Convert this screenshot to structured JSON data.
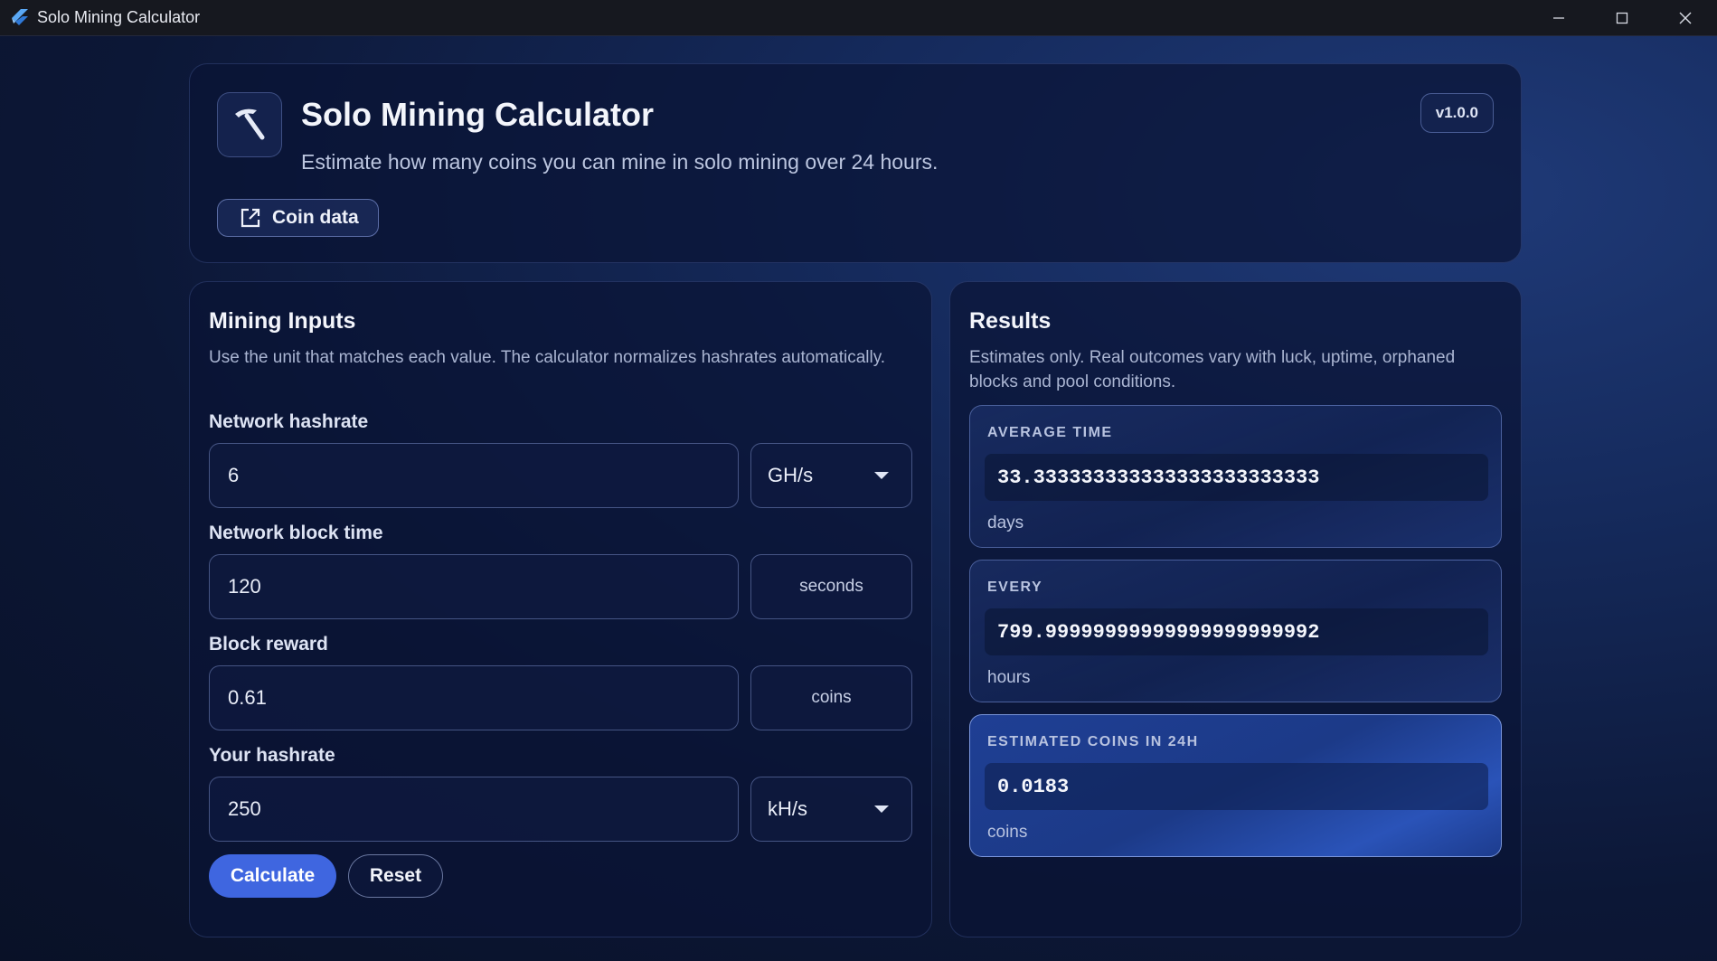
{
  "window": {
    "title": "Solo Mining Calculator",
    "minimize_glyph": "─",
    "maximize_glyph": "☐",
    "close_glyph": "✕"
  },
  "header": {
    "title": "Solo Mining Calculator",
    "subtitle": "Estimate how many coins you can mine in solo mining over 24 hours.",
    "version": "v1.0.0",
    "coin_data_label": "Coin data",
    "logo_icon": "pickaxe-icon",
    "coin_data_icon": "external-link-icon"
  },
  "inputs": {
    "title": "Mining Inputs",
    "description": "Use the unit that matches each value. The calculator normalizes hashrates automatically.",
    "network_hashrate": {
      "label": "Network hashrate",
      "value": "6",
      "unit": "GH/s"
    },
    "block_time": {
      "label": "Network block time",
      "value": "120",
      "unit": "seconds"
    },
    "block_reward": {
      "label": "Block reward",
      "value": "0.61",
      "unit": "coins"
    },
    "your_hashrate": {
      "label": "Your hashrate",
      "value": "250",
      "unit": "kH/s"
    },
    "calculate_label": "Calculate",
    "reset_label": "Reset"
  },
  "results": {
    "title": "Results",
    "description": "Estimates only. Real outcomes vary with luck, uptime, orphaned blocks and pool conditions.",
    "average_time": {
      "label": "AVERAGE TIME",
      "value": "33.333333333333333333333333",
      "unit": "days"
    },
    "every": {
      "label": "EVERY",
      "value": "799.99999999999999999999992",
      "unit": "hours"
    },
    "estimated": {
      "label": "ESTIMATED COINS IN 24H",
      "value": "0.0183",
      "unit": "coins"
    }
  },
  "colors": {
    "accent": "#3f66e0",
    "background": "#0c1736",
    "titlebar": "#16181f"
  }
}
